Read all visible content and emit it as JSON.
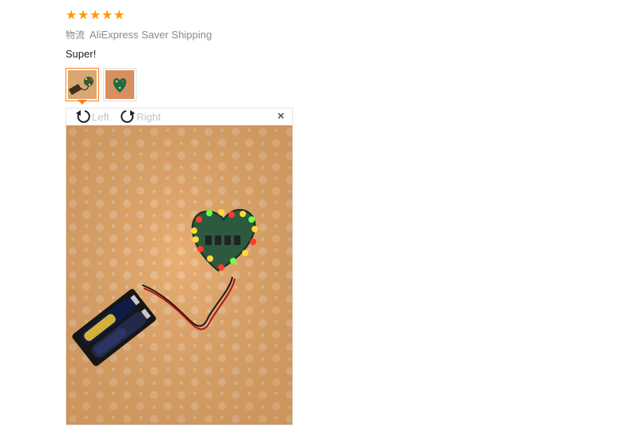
{
  "rating": {
    "stars": 5,
    "max": 5,
    "color": "#ff9a00",
    "icon": "star-icon"
  },
  "shipping": {
    "label": "物流",
    "method": "AliExpress Saver Shipping"
  },
  "review": {
    "text": "Super!"
  },
  "thumbnails": [
    {
      "name": "photo-thumbnail-1",
      "selected": true
    },
    {
      "name": "photo-thumbnail-2",
      "selected": false
    }
  ],
  "viewer": {
    "rotate_left_label": "Left",
    "rotate_right_label": "Right",
    "close_icon": "×",
    "accent": "#ff7e1a"
  }
}
